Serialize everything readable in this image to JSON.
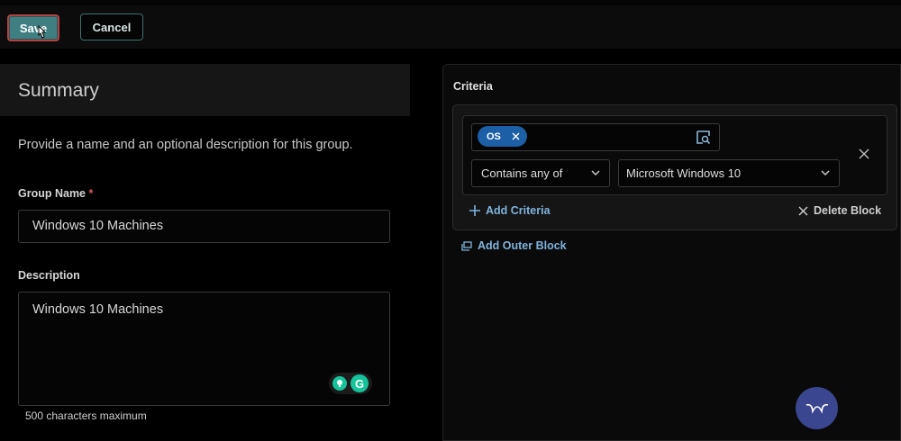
{
  "toolbar": {
    "save_label": "Save",
    "cancel_label": "Cancel"
  },
  "summary": {
    "title": "Summary",
    "description": "Provide a name and an optional description for this group.",
    "group_name_label": "Group Name",
    "required_marker": "*",
    "group_name_value": "Windows 10 Machines",
    "description_label": "Description",
    "description_value": "Windows 10 Machines",
    "max_chars_note": "500 characters maximum"
  },
  "criteria": {
    "title": "Criteria",
    "chip_label": "OS",
    "operator_value": "Contains any of",
    "value_selected": "Microsoft Windows 10",
    "add_criteria_label": "Add Criteria",
    "delete_block_label": "Delete Block",
    "add_outer_block_label": "Add Outer Block"
  },
  "icons": {
    "chip_remove": "close-icon",
    "lookup": "search-list-icon",
    "row_remove": "close-icon",
    "dropdown": "chevron-down-icon",
    "add": "plus-icon",
    "delete": "close-icon",
    "outer_block": "copy-block-icon",
    "assistant": "assistant-icon",
    "grammarly": "grammarly-icon"
  },
  "colors": {
    "save_button": "#3f7f82",
    "chip": "#1d5fa6",
    "link": "#7fb3dd",
    "required": "#e05a5a",
    "fab": "#3b4690"
  }
}
